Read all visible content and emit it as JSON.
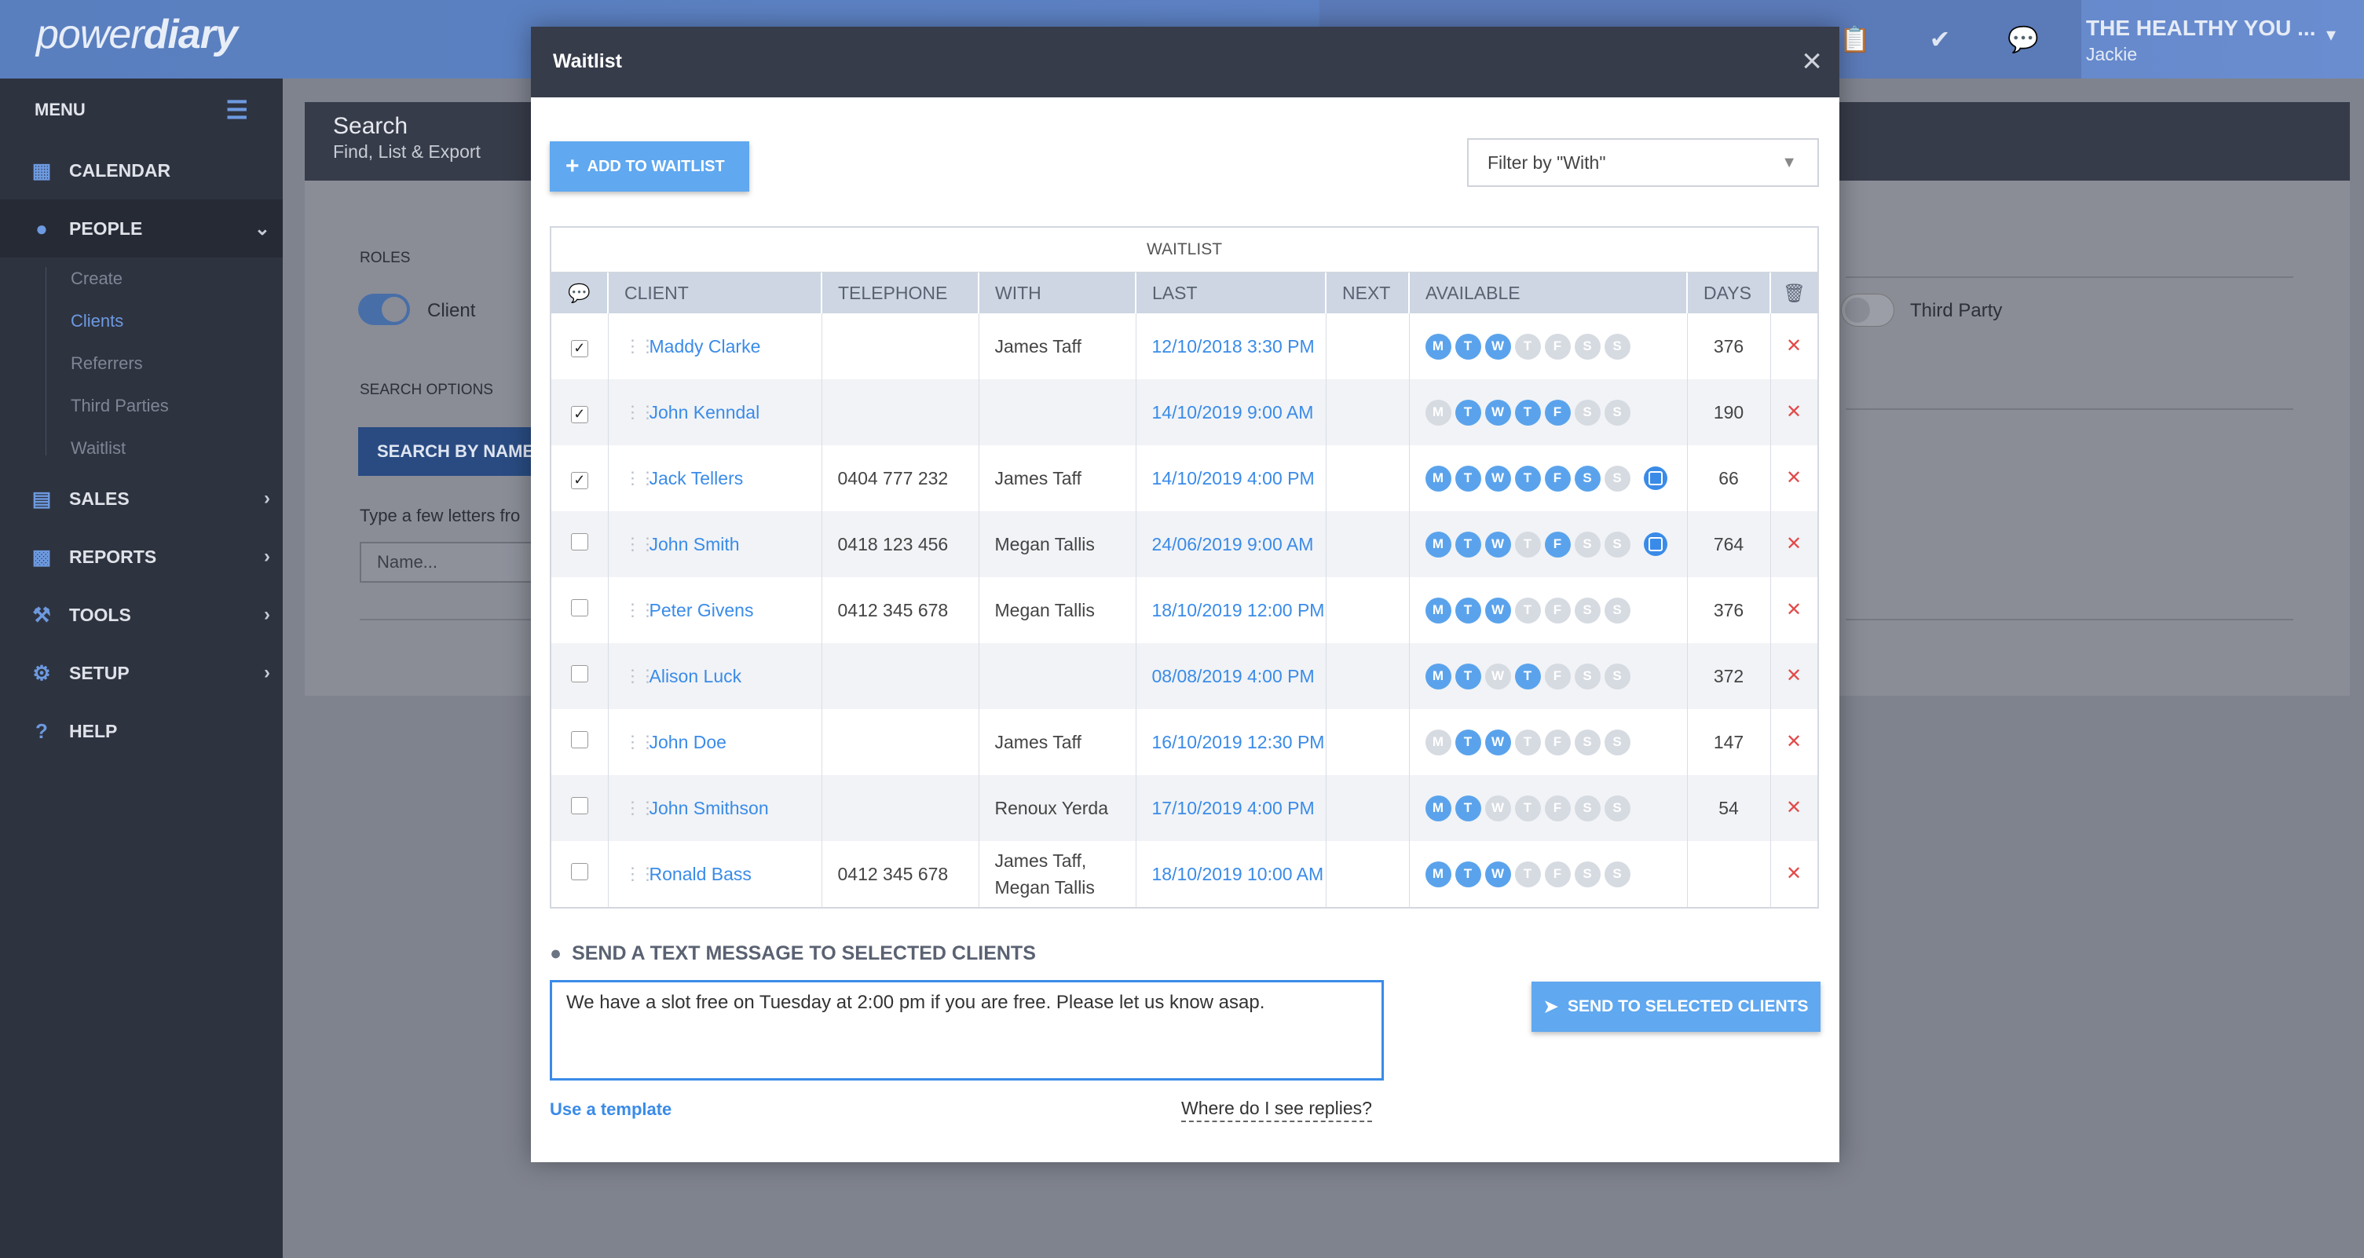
{
  "app": {
    "logo_light": "power",
    "logo_bold": "diary",
    "practice": "THE HEALTHY YOU ...",
    "user": "Jackie"
  },
  "sidebar": {
    "menu_label": "MENU",
    "items": [
      {
        "label": "CALENDAR",
        "icon": "calendar-icon"
      },
      {
        "label": "PEOPLE",
        "icon": "person-icon"
      },
      {
        "label": "SALES",
        "icon": "money-icon"
      },
      {
        "label": "REPORTS",
        "icon": "chart-icon"
      },
      {
        "label": "TOOLS",
        "icon": "wrench-icon"
      },
      {
        "label": "SETUP",
        "icon": "gear-icon"
      },
      {
        "label": "HELP",
        "icon": "help-icon"
      }
    ],
    "people_sub": [
      "Create",
      "Clients",
      "Referrers",
      "Third Parties",
      "Waitlist"
    ]
  },
  "page": {
    "title": "Search",
    "subtitle": "Find, List & Export",
    "roles_label": "ROLES",
    "role_client": "Client",
    "role_third_party": "Third Party",
    "search_options_label": "SEARCH OPTIONS",
    "search_button": "SEARCH BY NAME",
    "hint": "Type a few letters fro",
    "name_placeholder": "Name..."
  },
  "modal": {
    "title": "Waitlist",
    "add_button": "ADD TO WAITLIST",
    "filter_placeholder": "Filter by \"With\"",
    "table_caption": "WAITLIST",
    "columns": [
      "CLIENT",
      "TELEPHONE",
      "WITH",
      "LAST",
      "NEXT",
      "AVAILABLE",
      "DAYS"
    ],
    "day_letters": [
      "M",
      "T",
      "W",
      "T",
      "F",
      "S",
      "S"
    ],
    "rows": [
      {
        "checked": true,
        "client": "Maddy Clarke",
        "telephone": "",
        "with": "James Taff",
        "last": "12/10/2018 3:30 PM",
        "next": "",
        "available": [
          1,
          1,
          1,
          0,
          0,
          0,
          0
        ],
        "note": false,
        "days": "376"
      },
      {
        "checked": true,
        "client": "John Kenndal",
        "telephone": "",
        "with": "",
        "last": "14/10/2019 9:00 AM",
        "next": "",
        "available": [
          0,
          1,
          1,
          1,
          1,
          0,
          0
        ],
        "note": false,
        "days": "190"
      },
      {
        "checked": true,
        "client": "Jack Tellers",
        "telephone": "0404 777 232",
        "with": "James Taff",
        "last": "14/10/2019 4:00 PM",
        "next": "",
        "available": [
          1,
          1,
          1,
          1,
          1,
          1,
          0
        ],
        "note": true,
        "days": "66"
      },
      {
        "checked": false,
        "client": "John Smith",
        "telephone": "0418 123 456",
        "with": "Megan Tallis",
        "last": "24/06/2019 9:00 AM",
        "next": "",
        "available": [
          1,
          1,
          1,
          0,
          1,
          0,
          0
        ],
        "note": true,
        "days": "764"
      },
      {
        "checked": false,
        "client": "Peter Givens",
        "telephone": "0412 345 678",
        "with": "Megan Tallis",
        "last": "18/10/2019 12:00 PM",
        "next": "",
        "available": [
          1,
          1,
          1,
          0,
          0,
          0,
          0
        ],
        "note": false,
        "days": "376"
      },
      {
        "checked": false,
        "client": "Alison Luck",
        "telephone": "",
        "with": "",
        "last": "08/08/2019 4:00 PM",
        "next": "",
        "available": [
          1,
          1,
          0,
          1,
          0,
          0,
          0
        ],
        "note": false,
        "days": "372"
      },
      {
        "checked": false,
        "client": "John Doe",
        "telephone": "",
        "with": "James Taff",
        "last": "16/10/2019 12:30 PM",
        "next": "",
        "available": [
          0,
          1,
          1,
          0,
          0,
          0,
          0
        ],
        "note": false,
        "days": "147"
      },
      {
        "checked": false,
        "client": "John Smithson",
        "telephone": "",
        "with": "Renoux Yerda",
        "last": "17/10/2019 4:00 PM",
        "next": "",
        "available": [
          1,
          1,
          0,
          0,
          0,
          0,
          0
        ],
        "note": false,
        "days": "54"
      },
      {
        "checked": false,
        "client": "Ronald Bass",
        "telephone": "0412 345 678",
        "with": "James Taff, Megan Tallis",
        "last": "18/10/2019 10:00 AM",
        "next": "",
        "available": [
          1,
          1,
          1,
          0,
          0,
          0,
          0
        ],
        "note": false,
        "days": ""
      }
    ],
    "sms_title": "SEND A TEXT MESSAGE TO SELECTED CLIENTS",
    "sms_text": "We have a slot free on Tuesday at 2:00 pm if you are free. Please let us know asap.",
    "send_button": "SEND TO SELECTED CLIENTS",
    "template_link": "Use a template",
    "replies_link": "Where do I see replies?"
  },
  "colors": {
    "accent": "#3a8be8",
    "button": "#60a8f0",
    "sidebar": "#2e3340",
    "topbar": "#5d82c4",
    "delete": "#e24a4a"
  }
}
